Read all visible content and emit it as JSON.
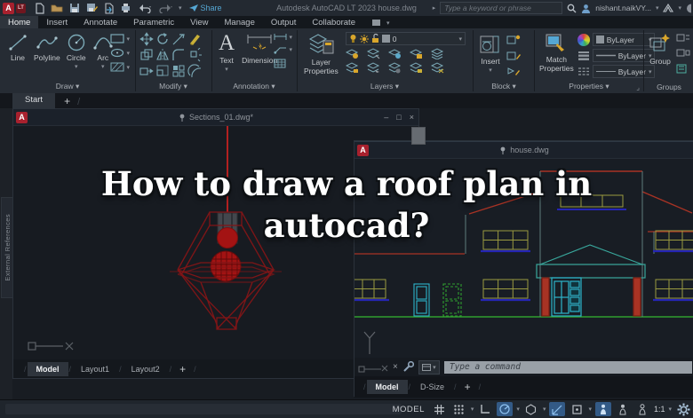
{
  "titlebar": {
    "logo_a": "A",
    "logo_lt": "LT",
    "share": "Share",
    "app_title": "Autodesk AutoCAD LT 2023    house.dwg",
    "search_placeholder": "Type a keyword or phrase",
    "user_name": "nishant.naikVY..."
  },
  "ribbon_tabs": {
    "home": "Home",
    "insert": "Insert",
    "annotate": "Annotate",
    "parametric": "Parametric",
    "view": "View",
    "manage": "Manage",
    "output": "Output",
    "collaborate": "Collaborate"
  },
  "draw_panel": {
    "label": "Draw",
    "line": "Line",
    "polyline": "Polyline",
    "circle": "Circle",
    "arc": "Arc"
  },
  "modify_panel": {
    "label": "Modify"
  },
  "annotation_panel": {
    "label": "Annotation",
    "text": "Text",
    "dimension": "Dimension"
  },
  "layers_panel": {
    "label": "Layers",
    "layer_properties_line1": "Layer",
    "layer_properties_line2": "Properties",
    "current_layer": "0"
  },
  "block_panel": {
    "label": "Block",
    "insert": "Insert"
  },
  "properties_panel": {
    "label": "Properties",
    "match_line1": "Match",
    "match_line2": "Properties",
    "color_value": "ByLayer",
    "linetype_value": "ByLayer",
    "lineweight_value": "ByLayer"
  },
  "groups_panel": {
    "label": "Groups",
    "group": "Group"
  },
  "file_tabs": {
    "start": "Start",
    "add": "+"
  },
  "palette_tab": "External References",
  "window_controls": {
    "minimize": "–",
    "maximize": "□",
    "close": "×"
  },
  "sections_window": {
    "title": "Sections_01.dwg*",
    "tab_model": "Model",
    "tab_layout1": "Layout1",
    "tab_layout2": "Layout2",
    "tab_add": "+"
  },
  "house_window": {
    "title": "house.dwg",
    "command_placeholder": "Type a command",
    "tab_model": "Model",
    "tab_dsize": "D-Size",
    "tab_add": "+"
  },
  "overlay": {
    "line1": "How to draw a roof plan in",
    "line2": "autocad?"
  },
  "statusbar": {
    "model": "MODEL",
    "annotation_scale": "1:1"
  },
  "colors": {
    "autocad_red": "#a8212e",
    "ribbon_icon_teal": "#7ba8b5",
    "icon_yellow": "#d9a62b",
    "share_blue": "#55a7d4",
    "status_active_blue": "#335a86",
    "lamp_red": "#a31313",
    "cage_red": "#7f1517",
    "house_roof_red": "#a83324",
    "house_cyan": "#2db4ca",
    "house_green": "#2f9e2f",
    "house_window_olive": "#9a9a40",
    "house_sill_blue": "#2525b5"
  }
}
